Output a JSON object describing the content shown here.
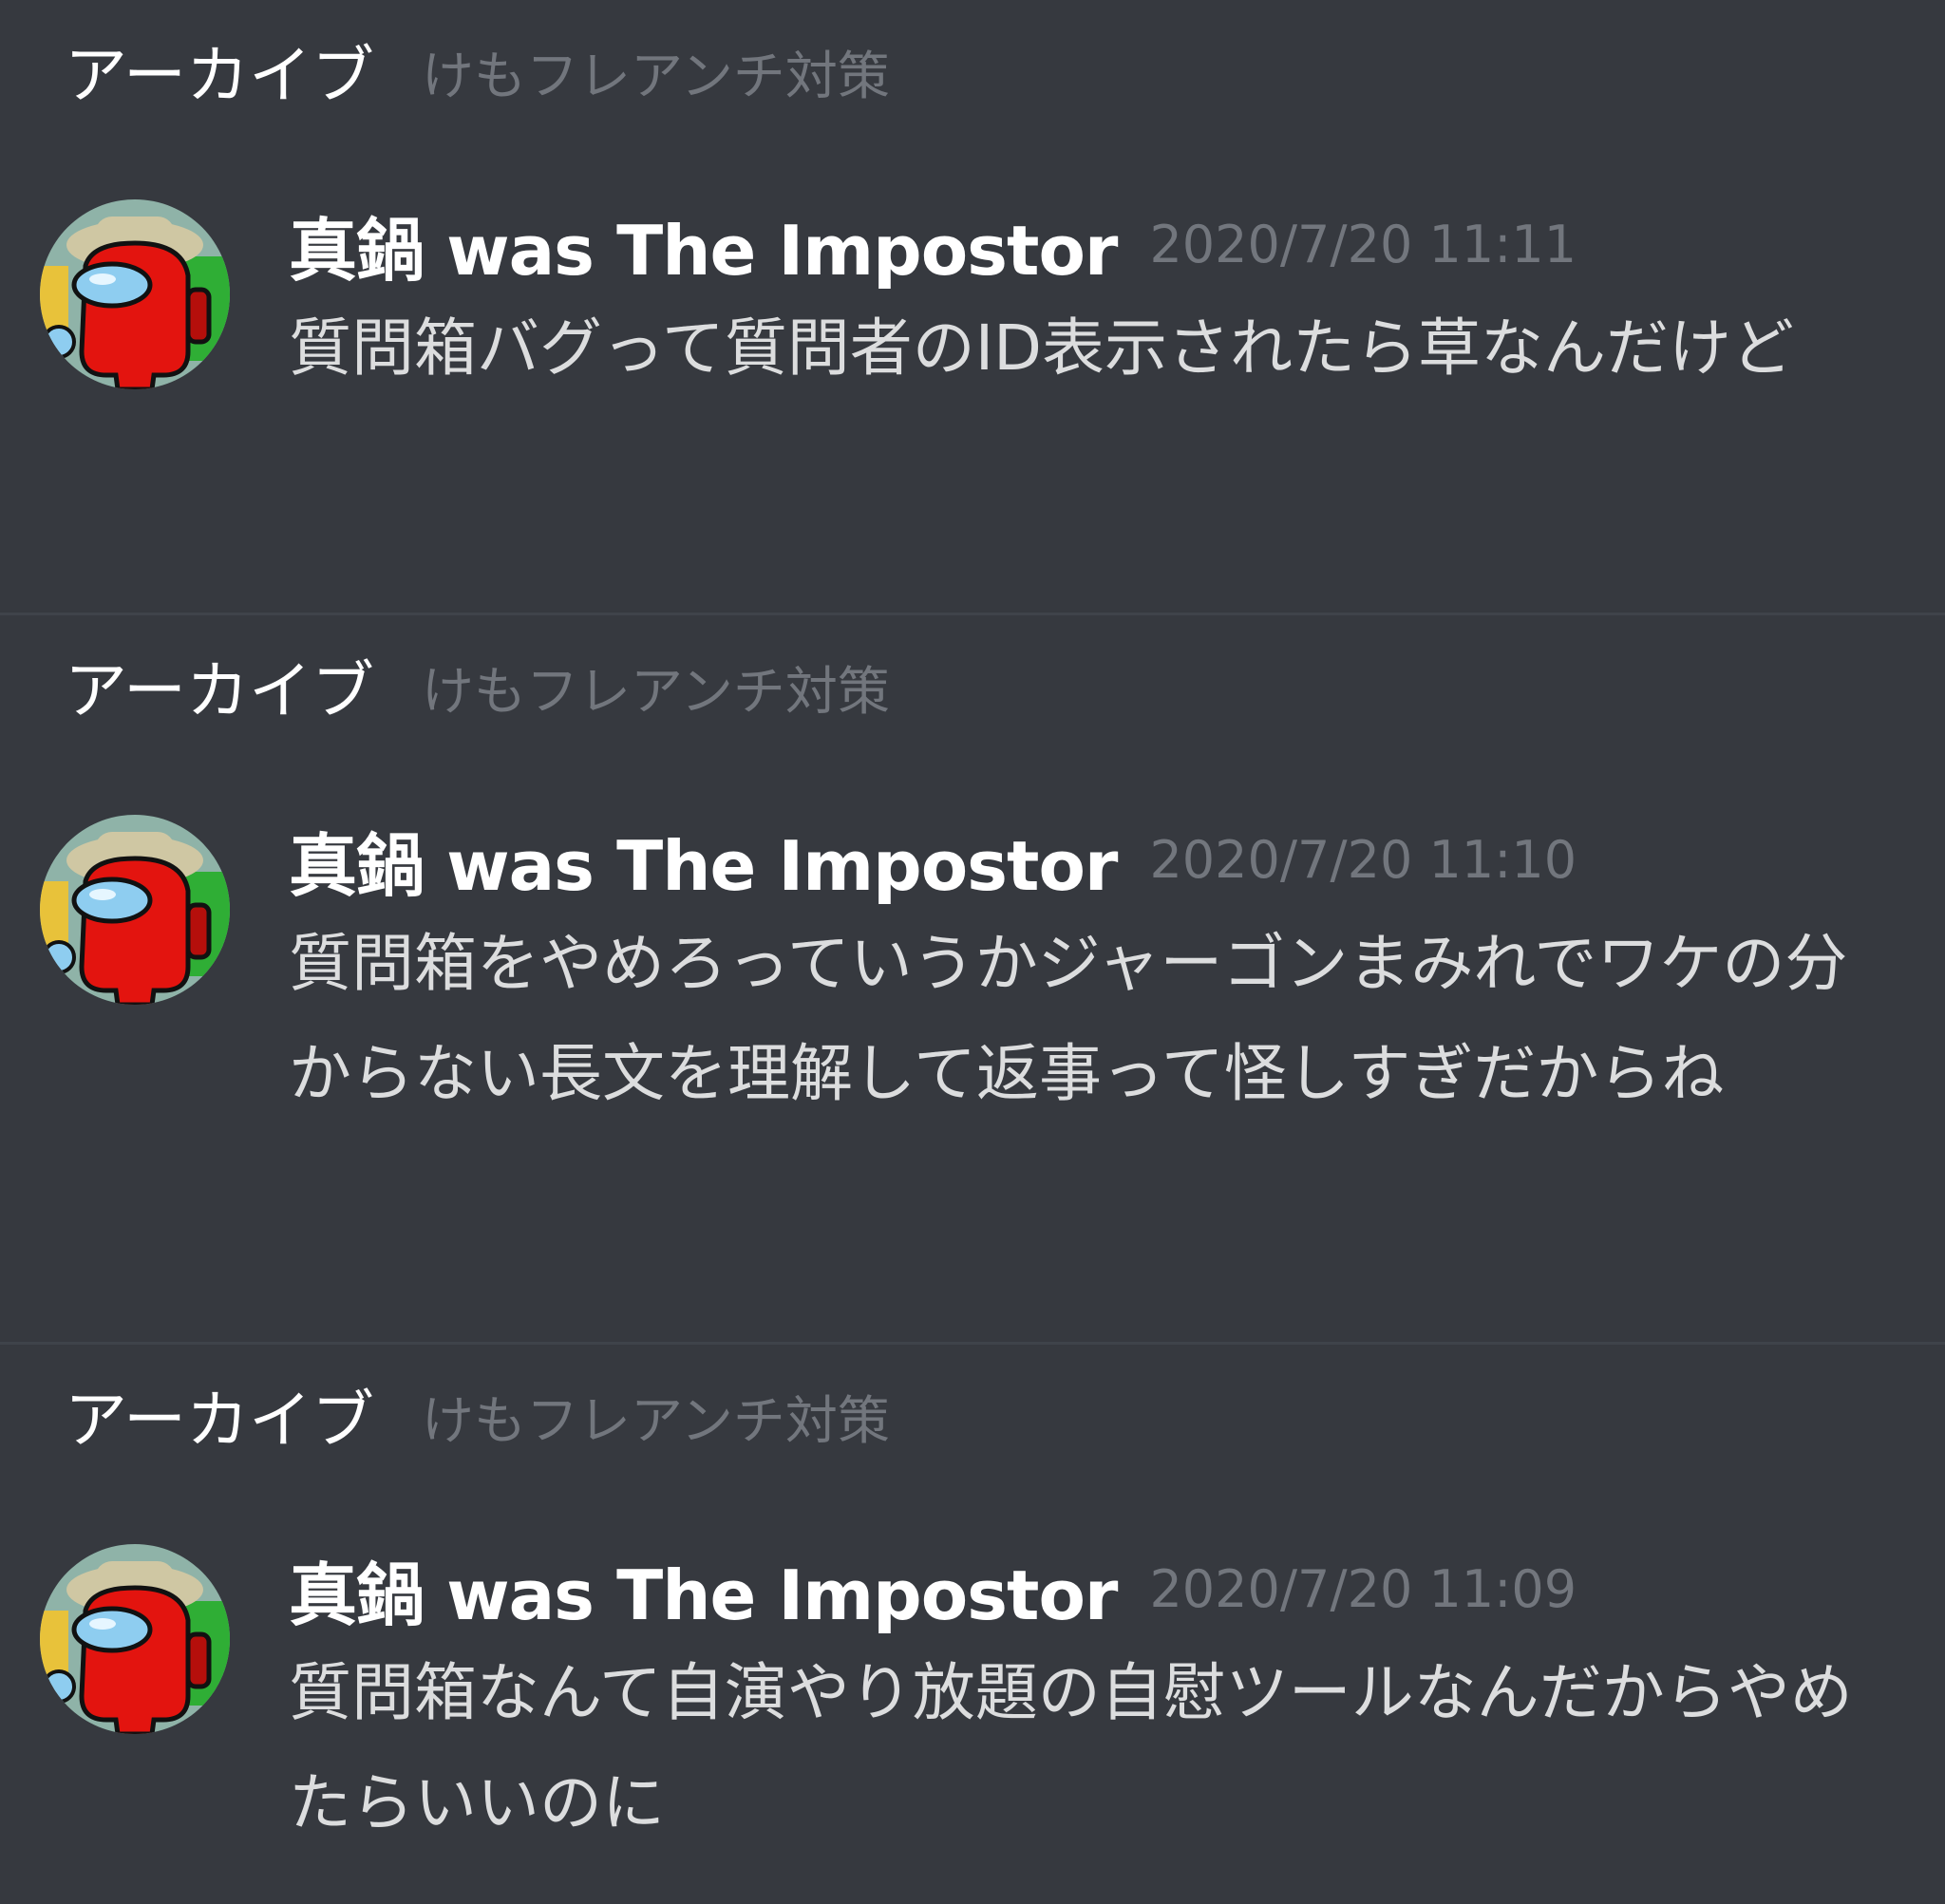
{
  "colors": {
    "background": "#36393f",
    "divider": "#3f434a",
    "author": "#ffffff",
    "timestamp": "#72767d",
    "text": "#dcddde",
    "channel": "#72767d",
    "avatar_bg": "#8fb3a8",
    "crewmate": "#e3140f",
    "visor": "#8ecdf0",
    "hat": "#cfc7a3"
  },
  "avatar_icon": "among-us-crewmate-red",
  "messages": [
    {
      "server": "アーカイブ",
      "channel": "けもフレアンチ対策",
      "author": "真鍋 was The Impostor",
      "timestamp": "2020/7/20 11:11",
      "content": "質問箱バグって質問者のID表示されたら草なんだけど"
    },
    {
      "server": "アーカイブ",
      "channel": "けもフレアンチ対策",
      "author": "真鍋 was The Impostor",
      "timestamp": "2020/7/20 11:10",
      "content": "質問箱をやめろっていうかジャーゴンまみれでワケの分からない長文を理解して返事って怪しすぎだからね"
    },
    {
      "server": "アーカイブ",
      "channel": "けもフレアンチ対策",
      "author": "真鍋 was The Impostor",
      "timestamp": "2020/7/20 11:09",
      "content": "質問箱なんて自演やり放題の自慰ツールなんだからやめたらいいのに"
    }
  ]
}
